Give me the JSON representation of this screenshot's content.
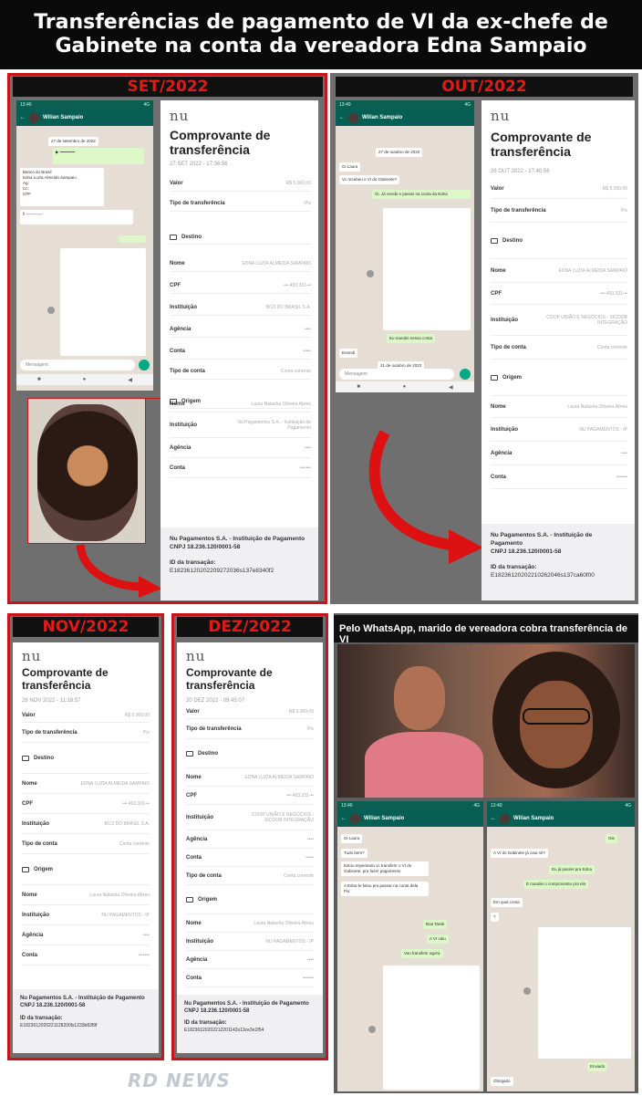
{
  "headline": {
    "line1": "Transferências de pagamento de VI da ex-chefe de",
    "line2": "Gabinete na conta da vereadora Edna Sampaio"
  },
  "months": {
    "set": "SET/2022",
    "out": "OUT/2022",
    "nov": "NOV/2022",
    "dez": "DEZ/2022"
  },
  "whatsapp_caption": "Pelo WhatsApp, marido de vereadora cobra transferência de VI",
  "receipt_common": {
    "logo": "nu",
    "title": "Comprovante de transferência",
    "valor": "Valor",
    "tipo": "Tipo de transferência",
    "tipo_val": "Pix",
    "destino": "Destino",
    "origem": "Origem",
    "nome": "Nome",
    "cpf": "CPF",
    "instituicao": "Instituição",
    "agencia": "Agência",
    "conta": "Conta",
    "tipo_conta": "Tipo de conta",
    "footer_name": "Nu Pagamentos S.A. - Instituição de Pagamento",
    "footer_cnpj": "CNPJ 18.236.120/0001-58",
    "id_label": "ID da transação:"
  },
  "receipts": {
    "set": {
      "date": "27 SET 2022 - 17:36:56",
      "valor_val": "R$ 5.000,00",
      "dest_nome": "EDNA LUZIA ALMEIDA SAMPAIO",
      "dest_cpf": "•••.493.331-••",
      "dest_inst": "BCO DO BRASIL S.A.",
      "dest_tipo": "Conta corrente",
      "orig_nome": "Laura Natasha Oliveira Abreu",
      "orig_inst": "Nu Pagamentos S.A. - Instituição de Pagamento",
      "tx_id": "E18236120202209272036s137e8340f2"
    },
    "out": {
      "date": "26 OUT 2022 - 17:40:56",
      "valor_val": "R$ 5.000,00",
      "dest_nome": "EDNA LUZIA ALMEIDA SAMPAIO",
      "dest_cpf": "•••.493.331-••",
      "dest_inst": "COOP UNIÃO E NEGÓCIOS - SICOOB INTEGRAÇÃO",
      "dest_tipo": "Conta corrente",
      "orig_nome": "Laura Natasha Oliveira Abreu",
      "orig_inst": "NU PAGAMENTOS - IP",
      "tx_id": "E18236120202210262046s137ca60f00"
    },
    "nov": {
      "date": "28 NOV 2022 - 11:18:57",
      "valor_val": "R$ 5.000,00",
      "dest_nome": "EDNA LUZIA ALMEIDA SAMPAIO",
      "dest_cpf": "•••.493.331-••",
      "dest_inst": "BCO DO BRASIL S.A.",
      "dest_tipo": "Conta corrente",
      "orig_nome": "Laura Natasha Oliveira Abreu",
      "orig_inst": "NU PAGAMENTOS - IP",
      "tx_id": "E1823612020221128200ls1233b83f9f"
    },
    "dez": {
      "date": "20 DEZ 2022 - 09:45:07",
      "valor_val": "R$ 5.000,00",
      "dest_nome": "EDNA LUZIA ALMEIDA SAMPAIO",
      "dest_cpf": "•••.493.331-••",
      "dest_inst": "COOP UNIÃO E NEGÓCIOS - SICOOB INTEGRAÇÃO",
      "dest_tipo": "Conta corrente",
      "orig_nome": "Laura Natasha Oliveira Abreu",
      "orig_inst": "NU PAGAMENTOS - IP",
      "tx_id": "E18236120202212201143s13ce3e1f54"
    }
  },
  "wa": {
    "contact": "Wilian Sampaio",
    "input_placeholder": "Mensagem",
    "set_msg": "Banco do Brasil\nEdna Luzia Almeida Sampaio\nAg:\nCc:\nCPF",
    "set_date": "27 de setembro de 2022",
    "out_date": "27 de outubro de 2022",
    "out_m1": "Oi Laura",
    "out_m2": "Vc recebeu o VI do Gabinete?",
    "out_m3": "Oi. Já recebi e passei na conta da Edna",
    "out_m4": "Eu mandei nessa conta",
    "out_m5": "Enendi",
    "out_date2": "31 de outubro de 2022",
    "b1": "Oi Laura",
    "b2": "Tudo bem?",
    "b3": "Estou esperando vc transferir o VI do Gabinete, pra fazer pagamento",
    "b4": "A Edna te falou pra passar na conta dela Pix:",
    "b5": "Boa Tarde",
    "b6": "A VI caiu",
    "b7": "Vou transferir agora",
    "c1": "Oie",
    "c2": "A VI do Gabinete já caiu né?",
    "c3": "Eu já passei pra Edna",
    "c4": "E mandei o comprovante pra ela",
    "c5": "Em qual conta",
    "c6": "Enviado",
    "c7": "Obrigado"
  },
  "watermark": "RD NEWS",
  "colors": {
    "frame_red": "#c8141b",
    "month_red": "#e01919",
    "wa_green": "#075e54",
    "wa_bubble": "#dcf8c6"
  }
}
